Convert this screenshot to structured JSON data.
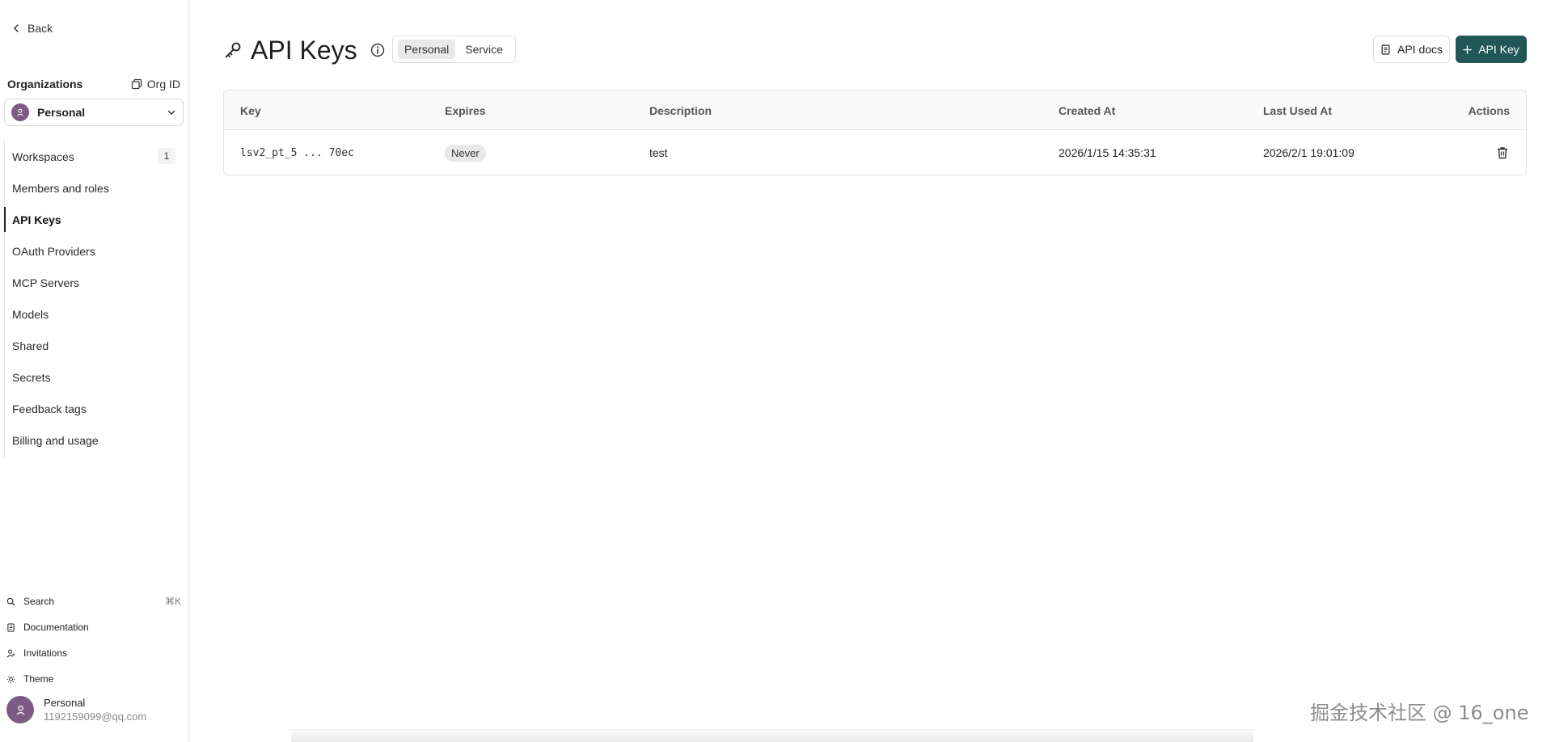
{
  "sidebar": {
    "back_label": "Back",
    "org_title": "Organizations",
    "org_id_label": "Org ID",
    "org_selected": "Personal",
    "nav": [
      {
        "label": "Workspaces",
        "badge": "1"
      },
      {
        "label": "Members and roles"
      },
      {
        "label": "API Keys",
        "active": true
      },
      {
        "label": "OAuth Providers"
      },
      {
        "label": "MCP Servers"
      },
      {
        "label": "Models"
      },
      {
        "label": "Shared"
      },
      {
        "label": "Secrets"
      },
      {
        "label": "Feedback tags"
      },
      {
        "label": "Billing and usage"
      }
    ],
    "bottom_links": [
      {
        "label": "Search",
        "icon": "search-icon",
        "shortcut": "⌘K"
      },
      {
        "label": "Documentation",
        "icon": "document-icon"
      },
      {
        "label": "Invitations",
        "icon": "user-plus-icon"
      },
      {
        "label": "Theme",
        "icon": "sun-icon"
      }
    ],
    "user": {
      "name": "Personal",
      "email": "1192159099@qq.com"
    }
  },
  "header": {
    "title": "API Keys",
    "tabs": [
      {
        "label": "Personal",
        "active": true
      },
      {
        "label": "Service"
      }
    ],
    "docs_label": "API docs",
    "add_label": "API Key"
  },
  "table": {
    "columns": [
      "Key",
      "Expires",
      "Description",
      "Created At",
      "Last Used At",
      "Actions"
    ],
    "rows": [
      {
        "key": "lsv2_pt_5 ... 70ec",
        "expires": "Never",
        "description": "test",
        "created_at": "2026/1/15 14:35:31",
        "last_used_at": "2026/2/1 19:01:09"
      }
    ]
  },
  "watermark": "掘金技术社区 @ 16_one",
  "colors": {
    "primary": "#22575a",
    "avatar": "#7c5c86"
  }
}
